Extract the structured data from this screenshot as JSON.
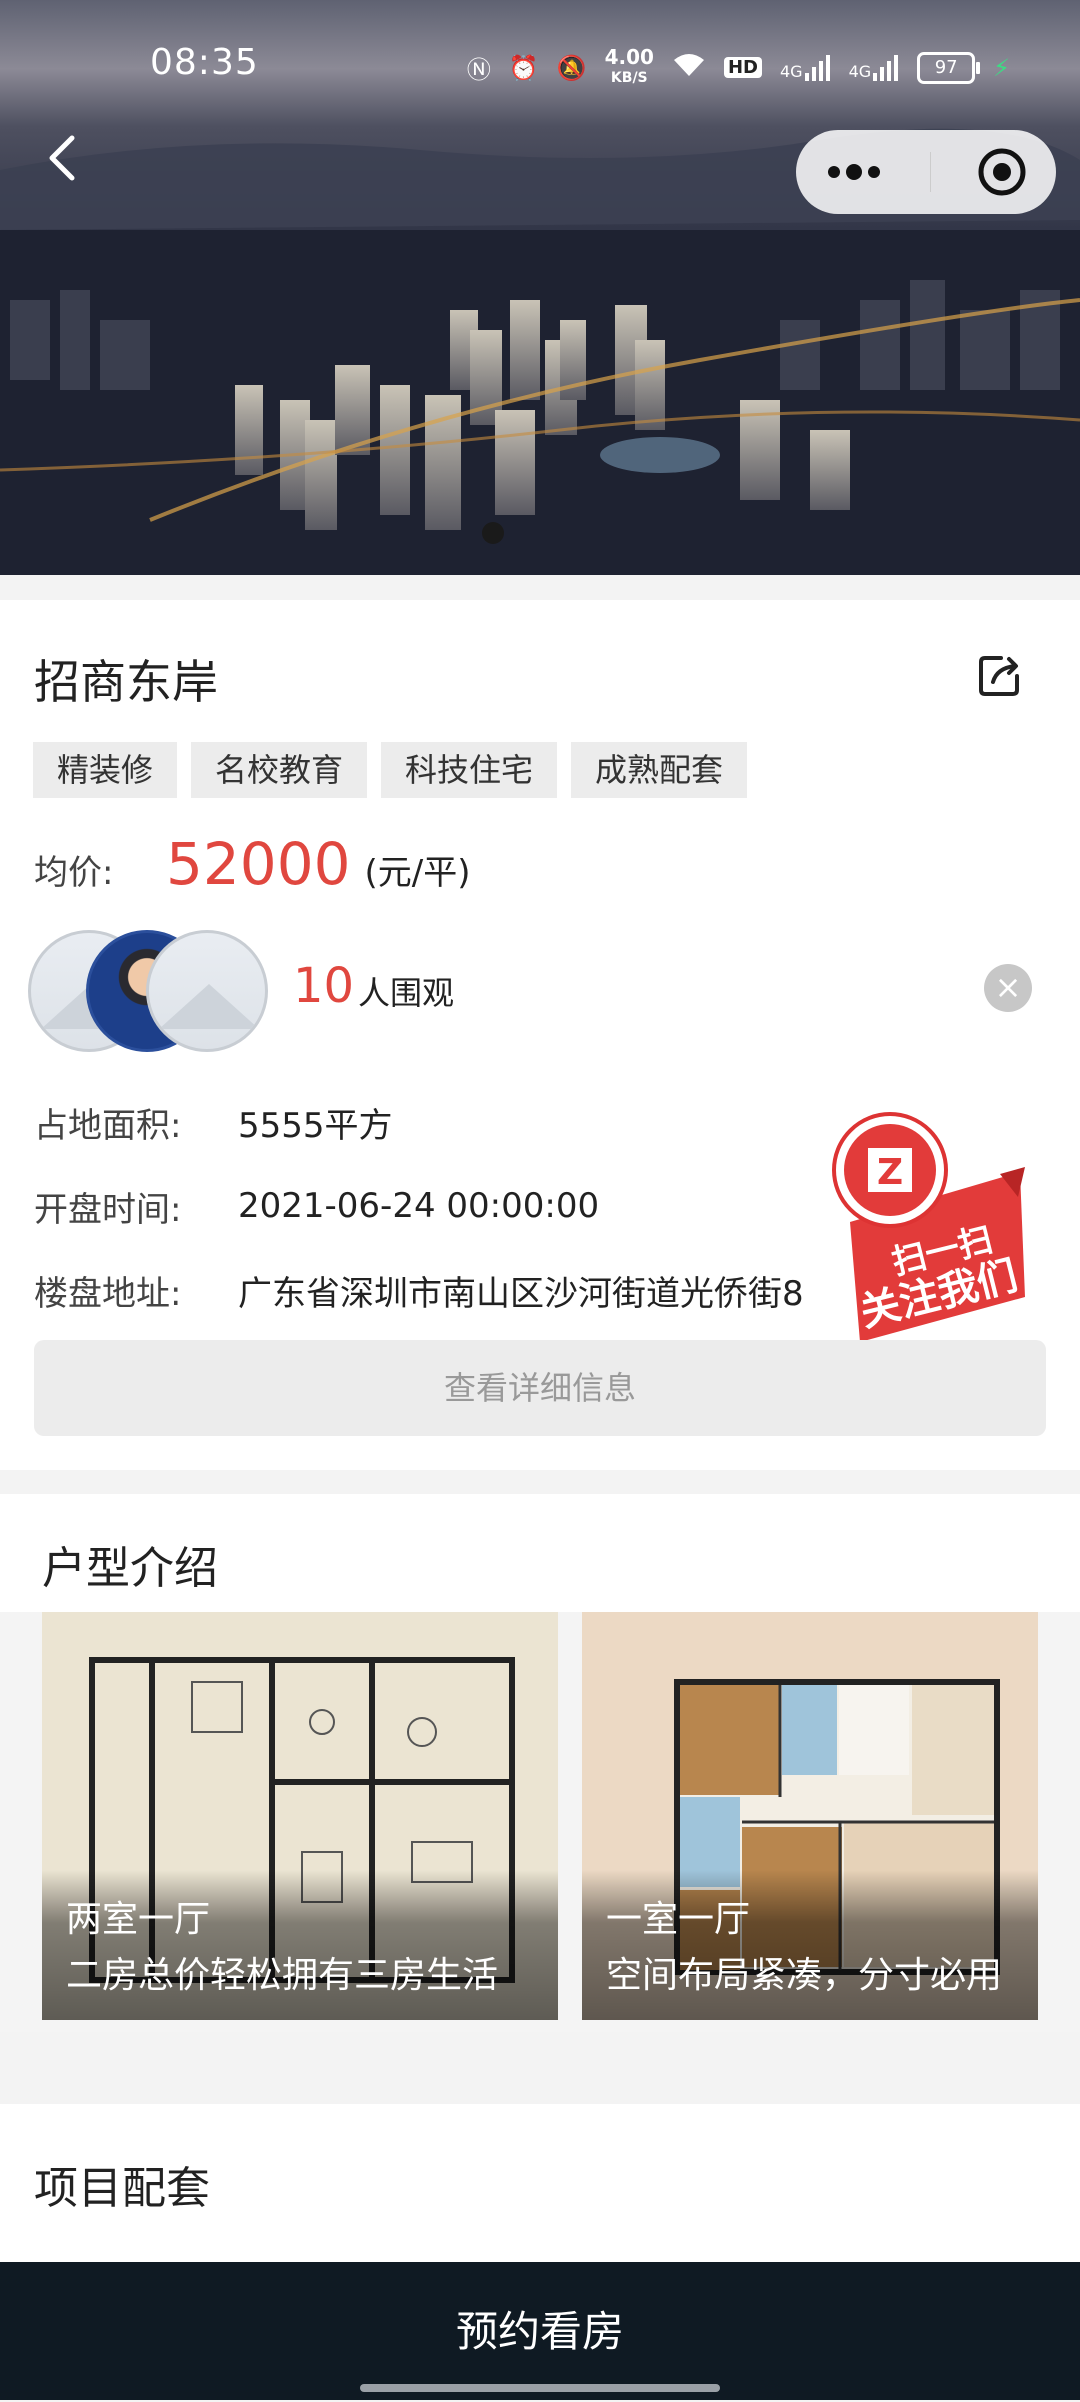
{
  "status_bar": {
    "time": "08:35",
    "net_speed_value": "4.00",
    "net_speed_unit": "KB/S",
    "hd_label": "HD",
    "signal1_label": "4G",
    "signal2_label": "4G",
    "battery": "97"
  },
  "hero": {
    "carousel_index": 1,
    "carousel_total": 1
  },
  "project": {
    "name": "招商东岸",
    "tags": [
      "精装修",
      "名校教育",
      "科技住宅",
      "成熟配套"
    ],
    "price_label": "均价:",
    "price_value": "52000",
    "price_unit": "(元/平)"
  },
  "viewers": {
    "count": "10",
    "text": "人围观"
  },
  "details": {
    "area_label": "占地面积:",
    "area_value": "5555平方",
    "open_label": "开盘时间:",
    "open_value": "2021-06-24 00:00:00",
    "address_label": "楼盘地址:",
    "address_value": "广东省深圳市南山区沙河街道光侨街8",
    "more_button": "查看详细信息"
  },
  "qr_badge": {
    "letter": "Z",
    "line1": "扫一扫",
    "line2": "关注我们"
  },
  "floor_plans": {
    "section_title": "户型介绍",
    "items": [
      {
        "title": "两室一厅",
        "desc": "二房总价轻松拥有三房生活"
      },
      {
        "title": "一室一厅",
        "desc": "空间布局紧凑，分寸必用"
      }
    ]
  },
  "facilities": {
    "section_title": "项目配套"
  },
  "bottom_bar": {
    "label": "预约看房"
  }
}
